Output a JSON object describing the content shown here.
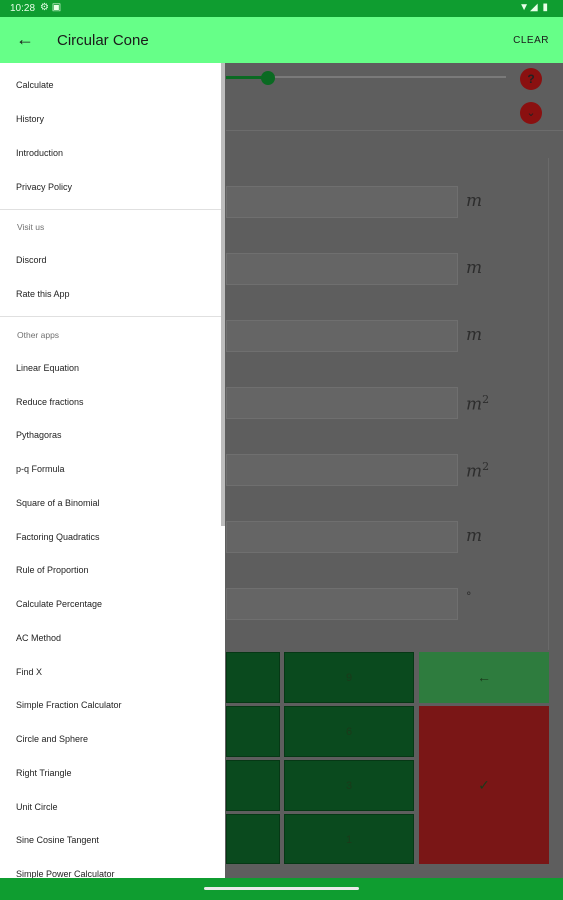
{
  "status_bar": {
    "time": "10:28",
    "left_icons": "⚙ ▣",
    "right_icons": "▼◢ ▮"
  },
  "app_bar": {
    "back_icon": "←",
    "title": "Circular Cone",
    "clear_label": "CLEAR"
  },
  "background": {
    "help_label": "?",
    "units": [
      "m",
      "m",
      "m",
      "m2",
      "m2",
      "m",
      "°"
    ],
    "keypad": {
      "row1_mid": "9",
      "row2_mid": "6",
      "row3_mid": "3",
      "row4_mid": "1",
      "backspace_icon": "←",
      "confirm_icon": "✓"
    }
  },
  "drawer": {
    "main_items": [
      "Calculate",
      "History",
      "Introduction",
      "Privacy Policy"
    ],
    "visit_header": "Visit us",
    "visit_items": [
      "Discord",
      "Rate this App"
    ],
    "other_header": "Other apps",
    "other_items": [
      "Linear Equation",
      "Reduce fractions",
      "Pythagoras",
      "p-q Formula",
      "Square of a Binomial",
      "Factoring Quadratics",
      "Rule of Proportion",
      "Calculate Percentage",
      "AC Method",
      "Find X",
      "Simple Fraction Calculator",
      "Circle and Sphere",
      "Right Triangle",
      "Unit Circle",
      "Sine Cosine Tangent",
      "Simple Power Calculator"
    ]
  },
  "colors": {
    "accent": "#66ff88",
    "status": "#0f9d30",
    "danger": "#8a1010"
  }
}
